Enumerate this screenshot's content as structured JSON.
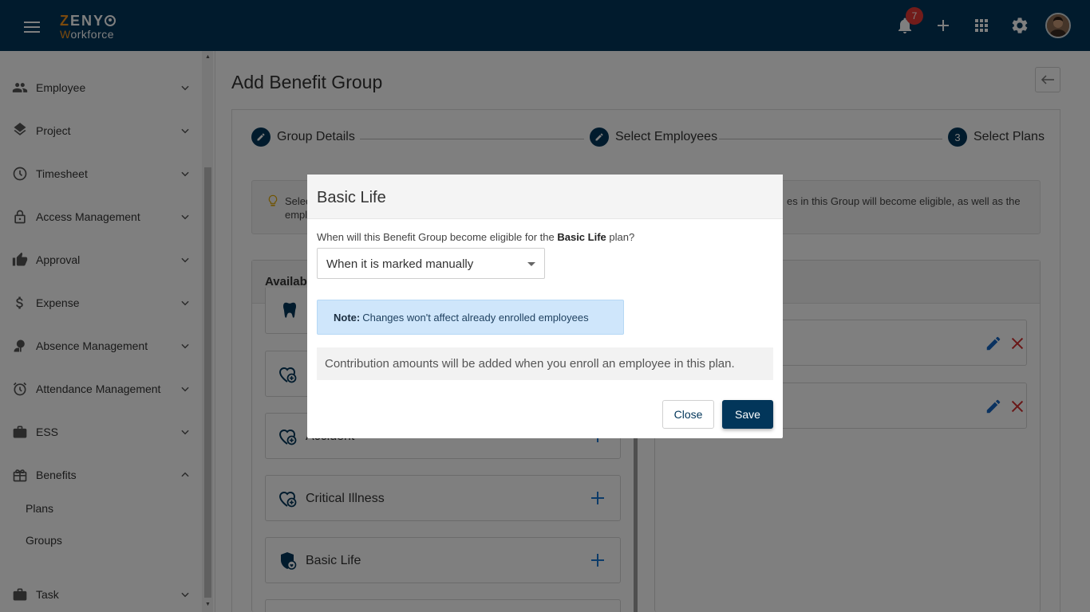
{
  "app": {
    "logo_top_first": "Z",
    "logo_top_rest": "ENY",
    "logo_bottom_first": "W",
    "logo_bottom_rest": "orkforce",
    "notification_count": "7",
    "brand_color": "#02365a"
  },
  "sidebar": {
    "items": [
      {
        "label": "Employee",
        "icon": "people-icon"
      },
      {
        "label": "Project",
        "icon": "layers-icon"
      },
      {
        "label": "Timesheet",
        "icon": "clock-icon"
      },
      {
        "label": "Access Management",
        "icon": "lock-icon"
      },
      {
        "label": "Approval",
        "icon": "thumbs-up-icon"
      },
      {
        "label": "Expense",
        "icon": "dollar-icon"
      },
      {
        "label": "Absence Management",
        "icon": "absence-icon"
      },
      {
        "label": "Attendance Management",
        "icon": "alarm-icon"
      },
      {
        "label": "ESS",
        "icon": "briefcase-icon"
      },
      {
        "label": "Benefits",
        "icon": "gift-icon"
      },
      {
        "label": "Task",
        "icon": "briefcase-icon"
      }
    ],
    "benefits_sub": [
      {
        "label": "Plans"
      },
      {
        "label": "Groups"
      }
    ]
  },
  "main": {
    "title": "Add Benefit Group",
    "steps": [
      {
        "label": "Group Details",
        "marker": "edit-icon"
      },
      {
        "label": "Select Employees",
        "marker": "edit-icon"
      },
      {
        "label": "Select Plans",
        "marker": "3"
      }
    ],
    "tip_left_line1": "Selec",
    "tip_left_line2": "empl",
    "tip_right": "es in this Group will become eligible, as well as the",
    "available_title": "Availab",
    "plans": [
      {
        "name": "Accident",
        "icon": "heart-plus-icon"
      },
      {
        "name": "Critical Illness",
        "icon": "heart-plus-icon"
      },
      {
        "name": "Basic Life",
        "icon": "shield-heart-icon"
      }
    ]
  },
  "modal": {
    "title": "Basic Life",
    "question_prefix": "When will this Benefit Group become eligible for the",
    "question_plan": "Basic Life",
    "question_suffix": "plan?",
    "eligibility_selected": "When it is marked manually",
    "note_label": "Note:",
    "note_text": "Changes won't affect already enrolled employees",
    "contribution_text": "Contribution amounts will be added when you enroll an employee in this plan.",
    "close_label": "Close",
    "save_label": "Save"
  }
}
